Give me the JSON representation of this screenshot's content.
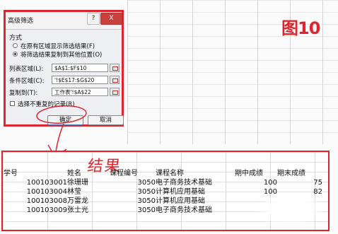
{
  "dialog": {
    "title": "高级筛选",
    "help_label": "?",
    "close_label": "X",
    "mode_label": "方式",
    "options": [
      {
        "label": "在原有区域显示筛选结果(F)",
        "selected": false
      },
      {
        "label": "将筛选结果复制到其他位置(O)",
        "selected": true
      }
    ],
    "fields": [
      {
        "label": "列表区域(L):",
        "value": "$A$1:$F$10"
      },
      {
        "label": "条件区域(C):",
        "value": "'!$E$17:$G$20"
      },
      {
        "label": "复制到(T):",
        "value": "工作表'!$A$22"
      }
    ],
    "unique_label": "选择不重复的记录(R)",
    "unique_checked": false,
    "ok_label": "确定",
    "cancel_label": "取消"
  },
  "figure_label": "图10",
  "result_word": "结果",
  "table": {
    "headers": [
      "学号",
      "姓名",
      "课程编号",
      "课程名称",
      "期中成绩",
      "期末成绩"
    ],
    "rows": [
      [
        "100103001",
        "徐珊珊",
        "3050",
        "电子商务技术基础",
        "100",
        "75"
      ],
      [
        "100103004",
        "林莹",
        "3050",
        "计算机应用基础",
        "100",
        "82"
      ],
      [
        "100103008",
        "万雷龙",
        "3050",
        "计算机应用基础",
        "",
        ""
      ],
      [
        "100103009",
        "张士光",
        "3050",
        "电子商务技术基础",
        "",
        ""
      ]
    ]
  },
  "colors": {
    "annotation": "#e0242d",
    "ok_focus": "#4c88c9"
  }
}
